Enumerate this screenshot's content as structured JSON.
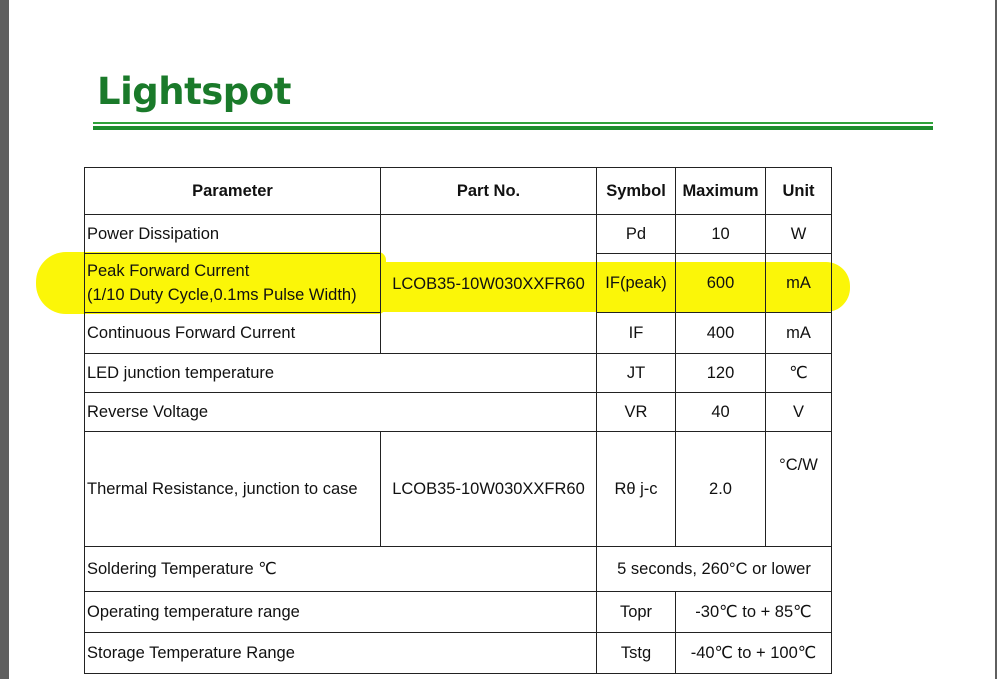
{
  "brand": {
    "logo_text": "Lightspot",
    "color": "#1a7a2a"
  },
  "highlight_color": "#fbf608",
  "table": {
    "headers": [
      "Parameter",
      "Part No.",
      "Symbol",
      "Maximum",
      "Unit"
    ],
    "part_no": "LCOB35-10W030XXFR60",
    "rows": [
      {
        "parameter": "Power Dissipation",
        "symbol": "Pd",
        "maximum": "10",
        "unit": "W"
      },
      {
        "parameter_line1": "Peak Forward Current",
        "parameter_line2": "(1/10 Duty Cycle,0.1ms Pulse Width)",
        "symbol": "IF(peak)",
        "maximum": "600",
        "unit": "mA"
      },
      {
        "parameter": "Continuous Forward Current",
        "symbol": "IF",
        "maximum": "400",
        "unit": "mA"
      },
      {
        "parameter": "LED junction temperature",
        "symbol": "JT",
        "maximum": "120",
        "unit": "℃"
      },
      {
        "parameter": "Reverse Voltage",
        "symbol": "VR",
        "maximum": "40",
        "unit": "V"
      },
      {
        "parameter": "Thermal Resistance, junction to case",
        "part_no": "LCOB35-10W030XXFR60",
        "symbol": "Rθ j-c",
        "maximum": "2.0",
        "unit": "°C/W"
      },
      {
        "parameter": "Soldering Temperature ℃",
        "value": "5 seconds, 260°C or lower"
      },
      {
        "parameter": "Operating temperature range",
        "symbol": "Topr",
        "value": "-30℃ to + 85℃"
      },
      {
        "parameter": "Storage Temperature Range",
        "symbol": "Tstg",
        "value": "-40℃ to + 100℃"
      }
    ]
  }
}
